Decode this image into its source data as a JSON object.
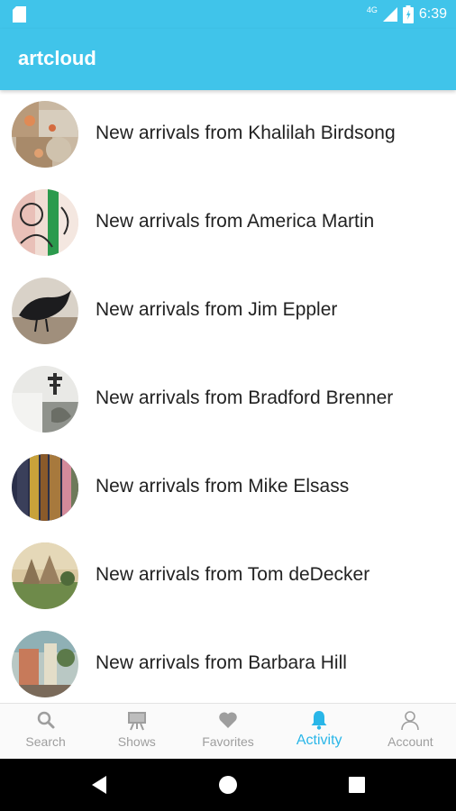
{
  "status_bar": {
    "time": "6:39",
    "network": "4G"
  },
  "app": {
    "title": "artcloud"
  },
  "activity": {
    "items": [
      {
        "text": "New arrivals from Khalilah Birdsong",
        "avatar": "avatar-khalilah-birdsong"
      },
      {
        "text": "New arrivals from America Martin",
        "avatar": "avatar-america-martin"
      },
      {
        "text": "New arrivals from Jim Eppler",
        "avatar": "avatar-jim-eppler"
      },
      {
        "text": "New arrivals from Bradford Brenner",
        "avatar": "avatar-bradford-brenner"
      },
      {
        "text": "New arrivals from Mike Elsass",
        "avatar": "avatar-mike-elsass"
      },
      {
        "text": "New arrivals from Tom deDecker",
        "avatar": "avatar-tom-dedecker"
      },
      {
        "text": "New arrivals from Barbara Hill",
        "avatar": "avatar-barbara-hill"
      }
    ]
  },
  "bottom_nav": {
    "tabs": [
      {
        "label": "Search",
        "icon": "search-icon"
      },
      {
        "label": "Shows",
        "icon": "easel-icon"
      },
      {
        "label": "Favorites",
        "icon": "heart-icon"
      },
      {
        "label": "Activity",
        "icon": "bell-icon",
        "active": true
      },
      {
        "label": "Account",
        "icon": "person-icon"
      }
    ]
  },
  "colors": {
    "primary": "#40c4ea",
    "active_tab": "#29b6e8",
    "inactive_tab": "#9e9e9e"
  }
}
